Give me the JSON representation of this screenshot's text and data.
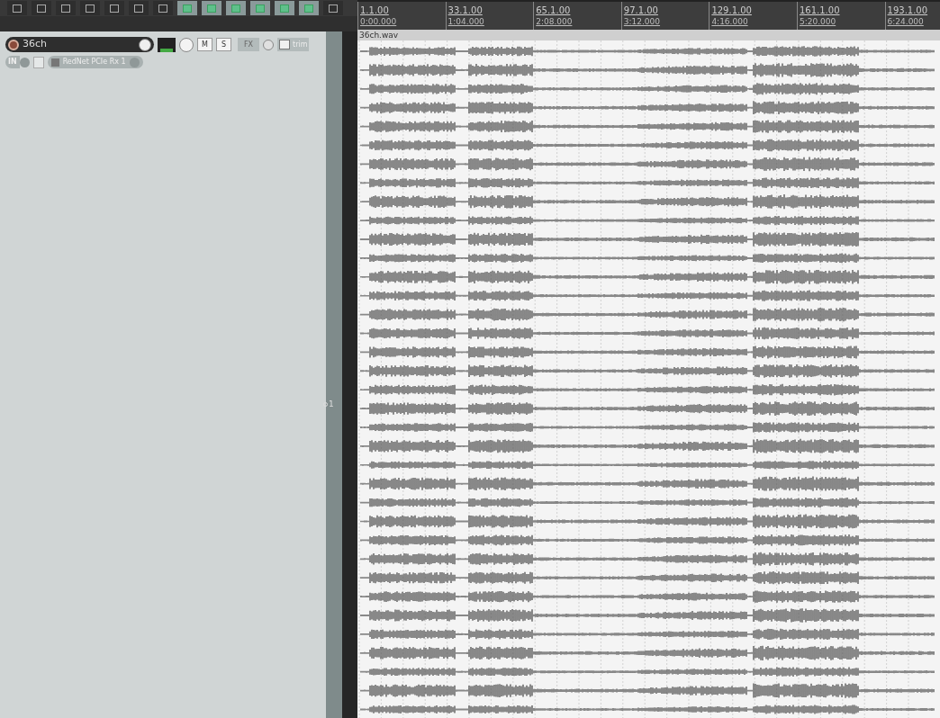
{
  "toolbar": {
    "buttons": [
      {
        "on": false
      },
      {
        "on": false
      },
      {
        "on": false
      },
      {
        "on": false
      },
      {
        "on": false
      },
      {
        "on": false
      },
      {
        "on": false
      },
      {
        "on": true
      },
      {
        "on": true
      },
      {
        "on": true
      },
      {
        "on": true
      },
      {
        "on": true
      },
      {
        "on": true
      },
      {
        "on": false
      }
    ]
  },
  "track": {
    "name": "36ch",
    "mute": "M",
    "solo": "S",
    "fx": "FX",
    "envelope": "trim",
    "input": "IN",
    "input_name": "RedNet PCIe Rx 1",
    "number": "1"
  },
  "ruler": {
    "markers": [
      {
        "bar": "1.1.00",
        "time": "0:00.000"
      },
      {
        "bar": "33.1.00",
        "time": "1:04.000"
      },
      {
        "bar": "65.1.00",
        "time": "2:08.000"
      },
      {
        "bar": "97.1.00",
        "time": "3:12.000"
      },
      {
        "bar": "129.1.00",
        "time": "4:16.000"
      },
      {
        "bar": "161.1.00",
        "time": "5:20.000"
      },
      {
        "bar": "193.1.00",
        "time": "6:24.000"
      }
    ]
  },
  "item": {
    "name": "36ch.wav"
  }
}
